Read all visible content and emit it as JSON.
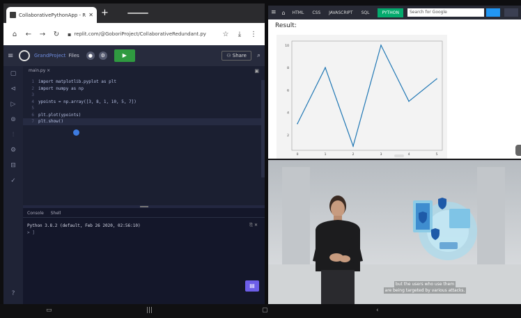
{
  "browser": {
    "tab_title": "CollaborativePythonApp - Rep",
    "new_tab": "+",
    "url": "replit.com/@GoboriProject/CollaborativeRedundant.py"
  },
  "ide": {
    "project": "GrandProject",
    "file": "Files",
    "share_label": "Share",
    "editor_tab": "main.py",
    "code_lines": [
      "import matplotlib.pyplot as plt",
      "import numpy as np",
      "",
      "ypoints = np.array([3, 8, 1, 10, 5, 7])",
      "",
      "plt.plot(ypoints)",
      "plt.show()"
    ],
    "console_tabs": [
      "Console",
      "Shell"
    ],
    "console_output": "Python 3.8.2 (default, Feb 26 2020, 02:56:10)",
    "console_prompt": "> ]"
  },
  "w3": {
    "nav": [
      "HTML",
      "CSS",
      "JAVASCRIPT",
      "SQL"
    ],
    "active": "PYTHON",
    "search_placeholder": "Search for Google",
    "result_label": "Result:"
  },
  "chart_data": {
    "type": "line",
    "x": [
      0,
      1,
      2,
      3,
      4,
      5
    ],
    "values": [
      3,
      8,
      1,
      10,
      5,
      7
    ],
    "ylim": [
      1,
      10
    ],
    "y_ticks": [
      "2",
      "4",
      "6",
      "8",
      "10"
    ],
    "x_ticks": [
      "0",
      "1",
      "2",
      "3",
      "4",
      "5"
    ],
    "color": "#1f77b4"
  },
  "video": {
    "subtitle_line1": "but the users who use them",
    "subtitle_line2": "are being targeted by various attacks."
  }
}
